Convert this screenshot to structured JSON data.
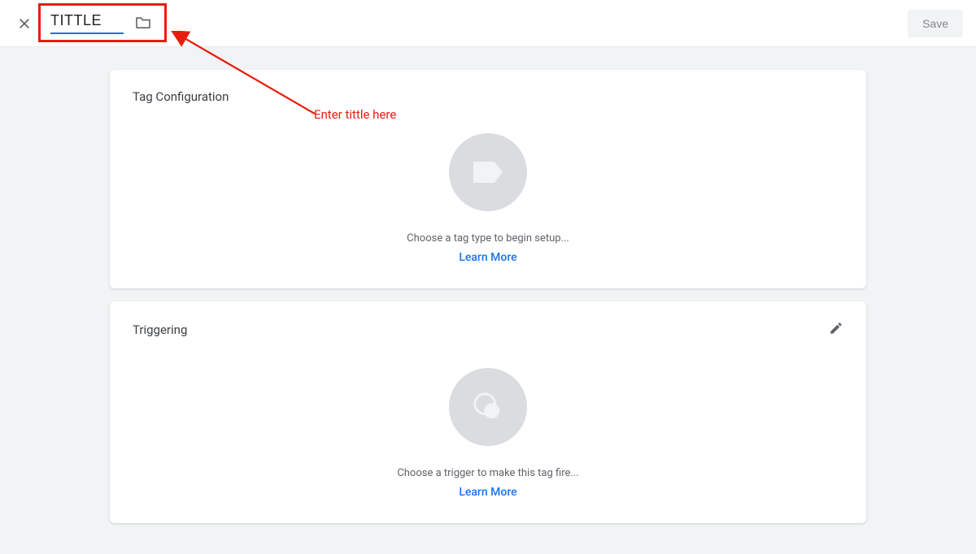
{
  "header": {
    "title_value": "TITTLE",
    "save_label": "Save"
  },
  "cards": {
    "tag_config": {
      "title": "Tag Configuration",
      "prompt": "Choose a tag type to begin setup...",
      "learn_more": "Learn More"
    },
    "triggering": {
      "title": "Triggering",
      "prompt": "Choose a trigger to make this tag fire...",
      "learn_more": "Learn More"
    }
  },
  "annotation": {
    "text": "Enter tittle here"
  },
  "colors": {
    "accent": "#1a73e8",
    "annotation": "#e81c0c"
  }
}
